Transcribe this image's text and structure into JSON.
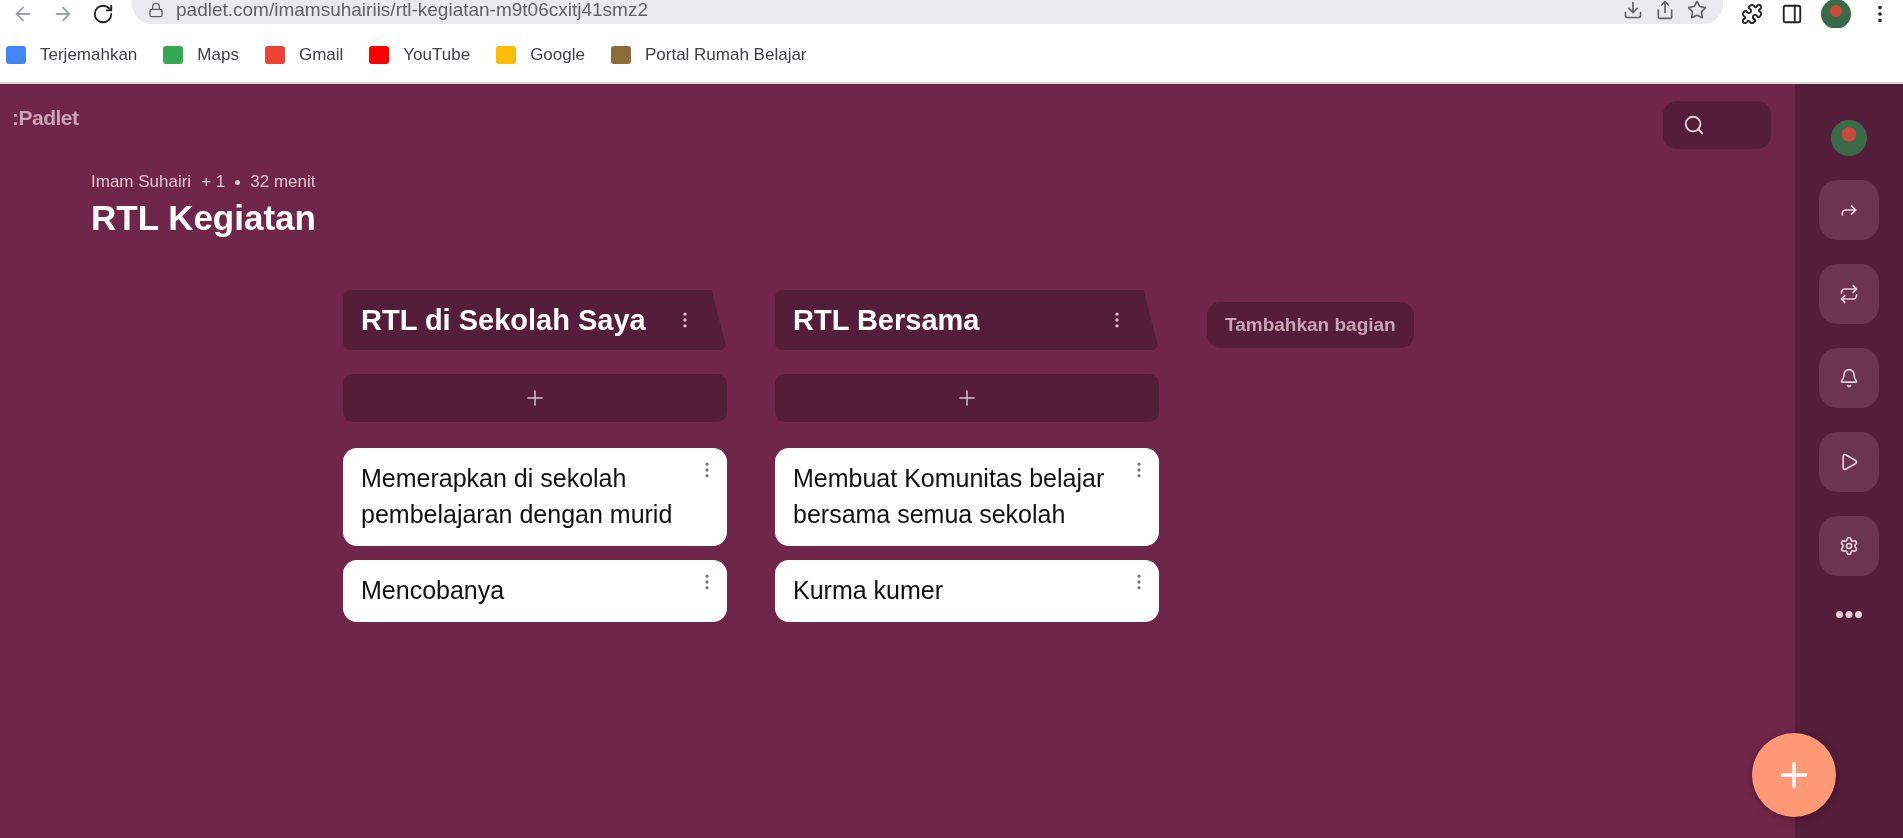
{
  "browser": {
    "url": "padlet.com/imamsuhairiis/rtl-kegiatan-m9t06cxitj41smz2",
    "bookmarks": [
      {
        "label": "Terjemahkan",
        "color": "#4285f4"
      },
      {
        "label": "Maps",
        "color": "#34a853"
      },
      {
        "label": "Gmail",
        "color": "#ea4335"
      },
      {
        "label": "YouTube",
        "color": "#ff0000"
      },
      {
        "label": "Google",
        "color": "#fbbc05"
      },
      {
        "label": "Portal Rumah Belajar",
        "color": "#8a6d3b"
      }
    ]
  },
  "padlet": {
    "logo": ":Padlet",
    "author": "Imam Suhairi",
    "collaborators": "+ 1",
    "time": "32 menit",
    "title": "RTL Kegiatan",
    "sections": [
      {
        "title": "RTL di Sekolah Saya",
        "posts": [
          "Memerapkan di sekolah pembelajaran dengan murid",
          "Mencobanya"
        ]
      },
      {
        "title": "RTL Bersama",
        "posts": [
          "Membuat Komunitas belajar bersama semua sekolah",
          "Kurma kumer"
        ]
      }
    ],
    "add_section": "Tambahkan bagian"
  }
}
